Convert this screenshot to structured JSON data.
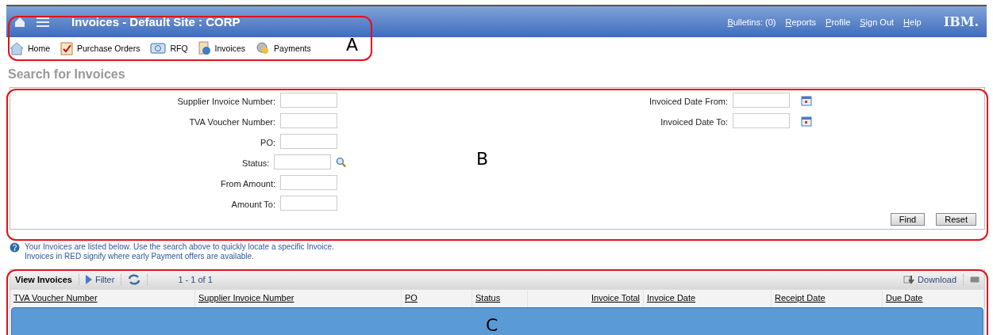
{
  "header": {
    "title": "Invoices - Default Site : CORP",
    "links": [
      "Bulletins: (0)",
      "Reports",
      "Profile",
      "Sign Out",
      "Help"
    ],
    "logo": "IBM."
  },
  "nav": [
    {
      "label": "Home",
      "kind": "home"
    },
    {
      "label": "Purchase Orders",
      "kind": "orders"
    },
    {
      "label": "RFQ",
      "kind": "rfq"
    },
    {
      "label": "Invoices",
      "kind": "invoices"
    },
    {
      "label": "Payments",
      "kind": "payments"
    }
  ],
  "page_title": "Search for Invoices",
  "search": {
    "left": [
      {
        "label": "Supplier Invoice Number:",
        "kind": "text"
      },
      {
        "label": "TVA Voucher Number:",
        "kind": "text"
      },
      {
        "label": "PO:",
        "kind": "text"
      },
      {
        "label": "Status:",
        "kind": "lookup"
      },
      {
        "label": "From Amount:",
        "kind": "text"
      },
      {
        "label": "Amount To:",
        "kind": "text"
      }
    ],
    "right": [
      {
        "label": "Invoiced Date From:",
        "kind": "date"
      },
      {
        "label": "Invoiced Date To:",
        "kind": "date"
      }
    ],
    "buttons": [
      "Find",
      "Reset"
    ]
  },
  "help": [
    "Your Invoices are listed below. Use the search above to quickly locate a specific Invoice.",
    "Invoices in RED signify where early Payment offers are available."
  ],
  "grid": {
    "title": "View Invoices",
    "filter": "Filter",
    "paging": "1 - 1 of 1",
    "download": "Download",
    "columns": [
      "TVA Voucher Number",
      "Supplier Invoice Number",
      "PO",
      "Status",
      "Invoice Total",
      "Invoice Date",
      "Receipt Date",
      "Due Date"
    ]
  },
  "annotations": [
    "A",
    "B",
    "C"
  ]
}
